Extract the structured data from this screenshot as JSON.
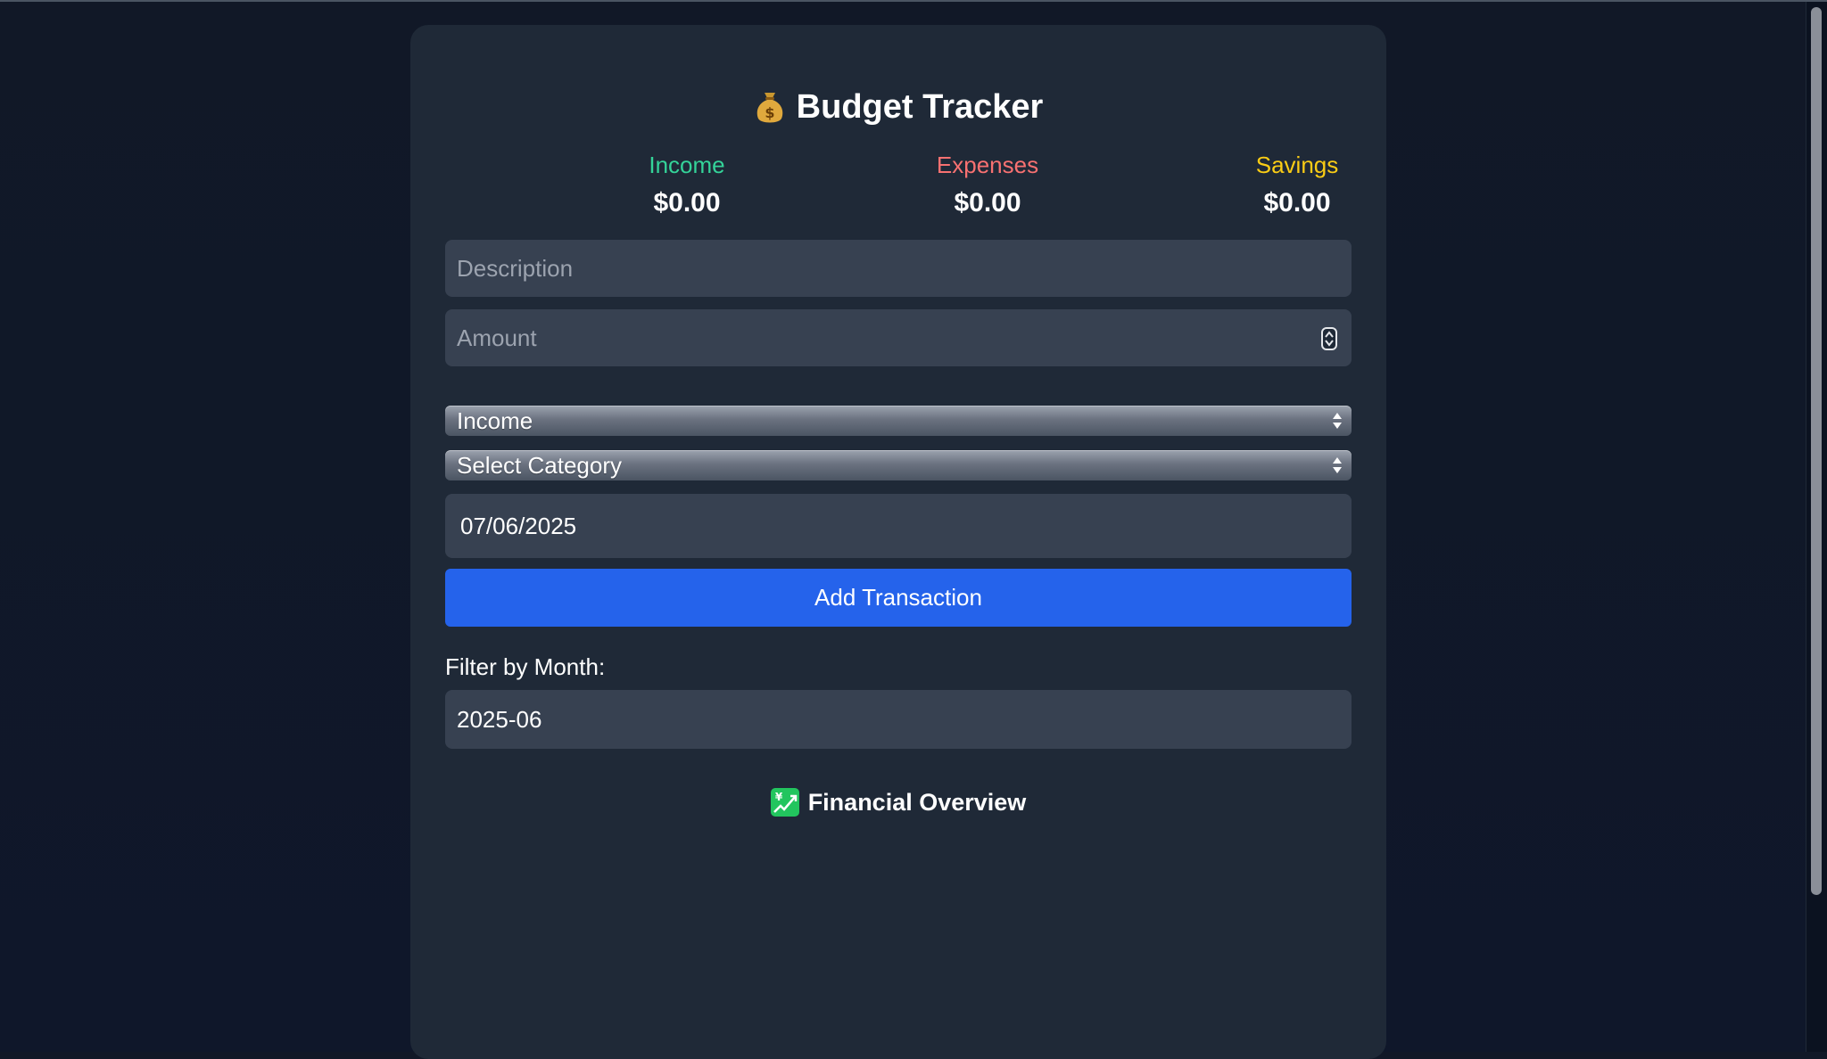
{
  "app": {
    "title": "Budget Tracker",
    "title_icon": "money-bag-icon"
  },
  "summary": {
    "income": {
      "label": "Income",
      "value": "$0.00",
      "color": "#34d399"
    },
    "expenses": {
      "label": "Expenses",
      "value": "$0.00",
      "color": "#f87171"
    },
    "savings": {
      "label": "Savings",
      "value": "$0.00",
      "color": "#facc15"
    }
  },
  "form": {
    "description": {
      "placeholder": "Description",
      "value": ""
    },
    "amount": {
      "placeholder": "Amount",
      "value": ""
    },
    "type_select": {
      "selected": "Income"
    },
    "category_select": {
      "selected": "Select Category"
    },
    "date": {
      "value": "07/06/2025"
    },
    "submit_label": "Add Transaction"
  },
  "filter": {
    "label": "Filter by Month:",
    "value": "2025-06"
  },
  "overview": {
    "title": "Financial Overview",
    "icon": "chart-increasing-yen-icon"
  },
  "colors": {
    "accent": "#2563eb",
    "card_bg": "#1f2937",
    "page_bg": "#111827",
    "input_bg": "#374151"
  }
}
